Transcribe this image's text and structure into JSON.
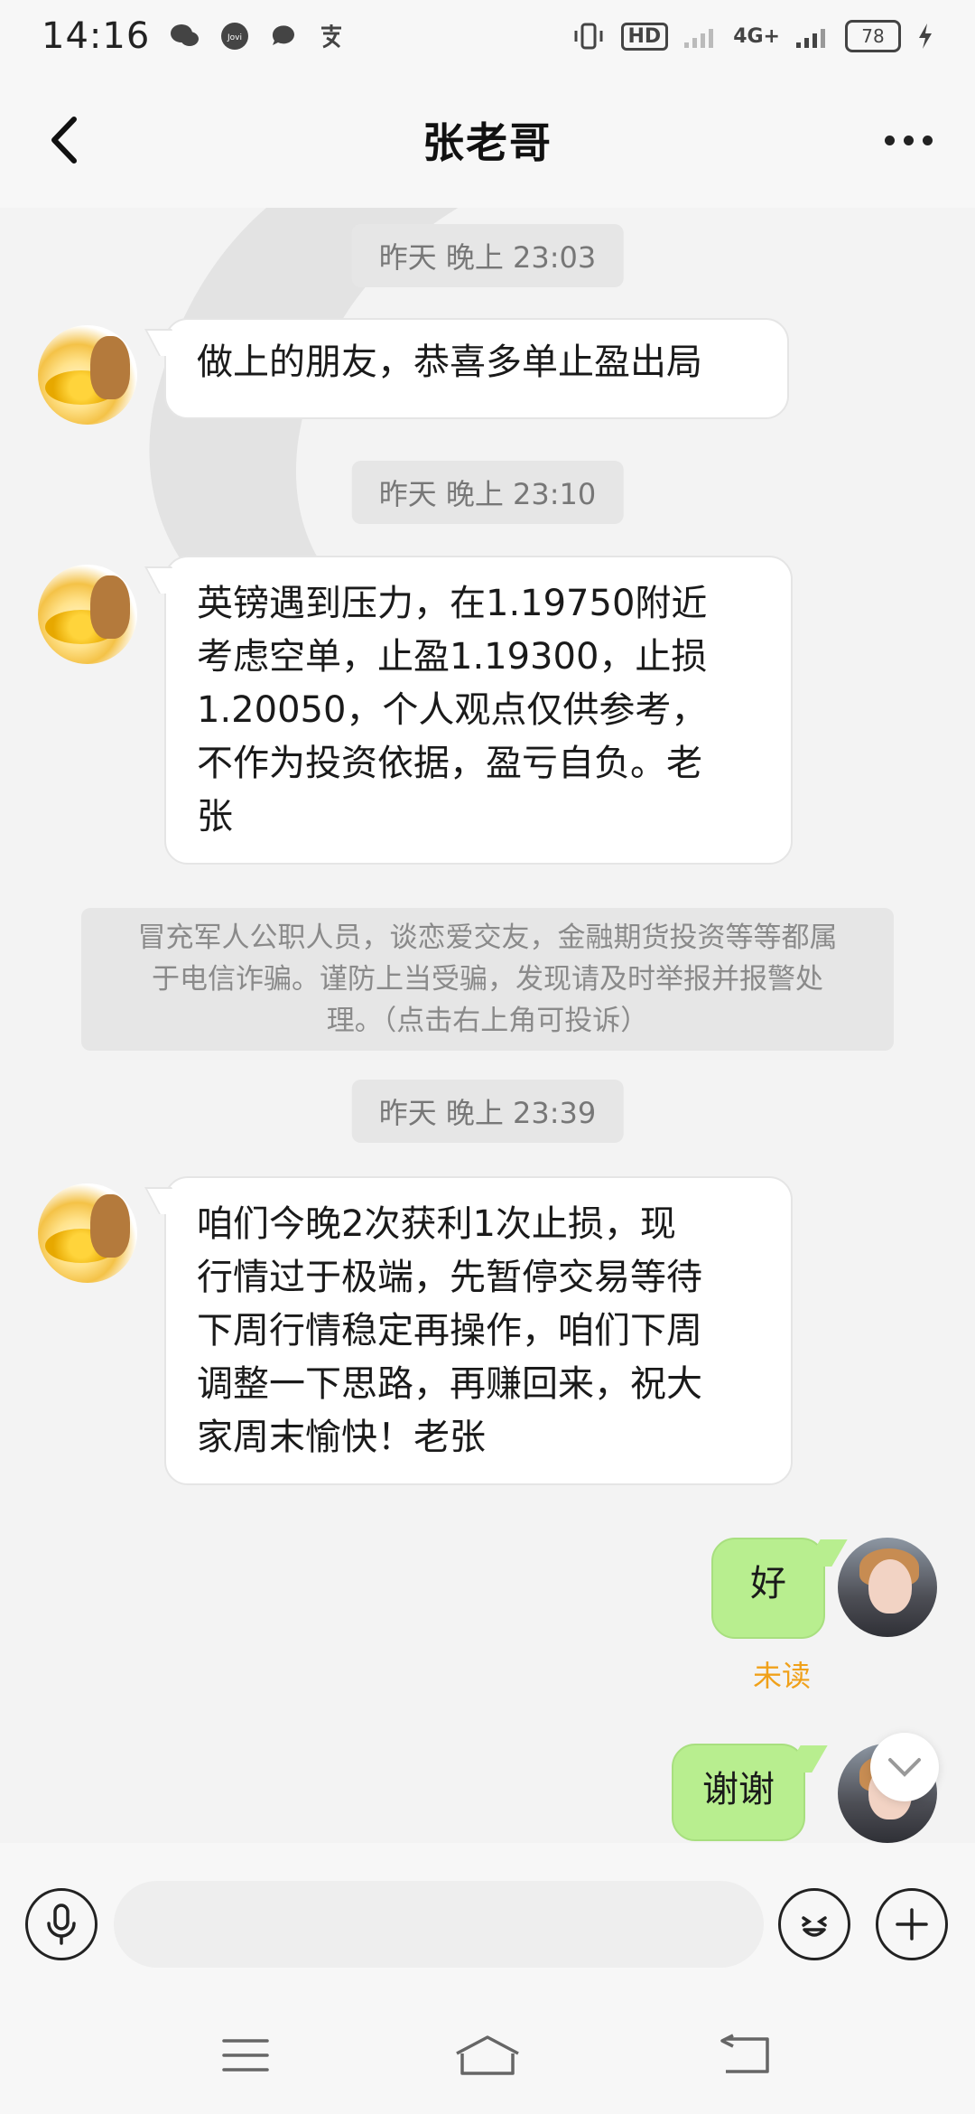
{
  "status_bar": {
    "time": "14:16",
    "app_icons": [
      "wechat-icon",
      "jovi-icon",
      "message-icon",
      "alipay-icon"
    ],
    "hd_label": "HD",
    "network": "4G+",
    "battery": "78"
  },
  "header": {
    "title": "张老哥"
  },
  "messages": [
    {
      "timestamp": "昨天 晚上 23:03",
      "text": "做上的朋友，恭喜多单止盈出局"
    },
    {
      "timestamp": "昨天 晚上 23:10",
      "lines": [
        "英镑遇到压力，在1.19750附近",
        "考虑空单，止盈1.19300，止损",
        "1.20050，个人观点仅供参考，",
        "不作为投资依据，盈亏自负。老",
        "张"
      ]
    },
    {
      "timestamp": "昨天 晚上 23:39",
      "lines": [
        "咱们今晚2次获利1次止损，现",
        "行情过于极端，先暂停交易等待",
        "下周行情稳定再操作，咱们下周",
        "调整一下思路，再赚回来，祝大",
        "家周末愉快！老张"
      ]
    }
  ],
  "notice": {
    "lines": [
      "冒充军人公职人员，谈恋爱交友，金融期货投资等等都属",
      "于电信诈骗。谨防上当受骗，发现请及时举报并报警处",
      "理。（点击右上角可投诉）"
    ]
  },
  "my_messages": [
    {
      "text": "好",
      "status": "未读"
    },
    {
      "text": "谢谢"
    }
  ],
  "input": {
    "placeholder": ""
  },
  "colors": {
    "my_bubble": "#b8ee8f",
    "unread": "#f0a11a",
    "background": "#f3f3f3"
  }
}
